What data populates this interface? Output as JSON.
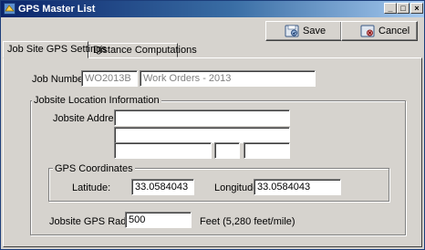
{
  "window": {
    "title": "GPS Master List",
    "controls": {
      "minimize": "_",
      "maximize": "□",
      "close": "×"
    }
  },
  "toolbar": {
    "save_label": "Save",
    "cancel_label": "Cancel"
  },
  "tabs": [
    {
      "label": "Job Site GPS Settings",
      "active": true
    },
    {
      "label": "Distance Computations",
      "active": false
    }
  ],
  "job": {
    "label": "Job Number:",
    "number": "WO2013B",
    "description": "Work Orders - 2013"
  },
  "jobsite_location": {
    "group_title": "Jobsite Location Information",
    "address_label": "Jobsite Address:",
    "address_line1": "",
    "address_line2": "",
    "city": "",
    "state": "",
    "zip": ""
  },
  "gps": {
    "group_title": "GPS Coordinates",
    "latitude_label": "Latitude:",
    "latitude": "33.0584043",
    "longitude_label": "Longitude:",
    "longitude": "33.0584043"
  },
  "radius": {
    "label": "Jobsite GPS Radius:",
    "value": "500",
    "unit_note": "Feet (5,280 feet/mile)"
  },
  "colors": {
    "titlebar_start": "#0a246a",
    "titlebar_end": "#a6caf0",
    "face": "#d6d3ce"
  }
}
